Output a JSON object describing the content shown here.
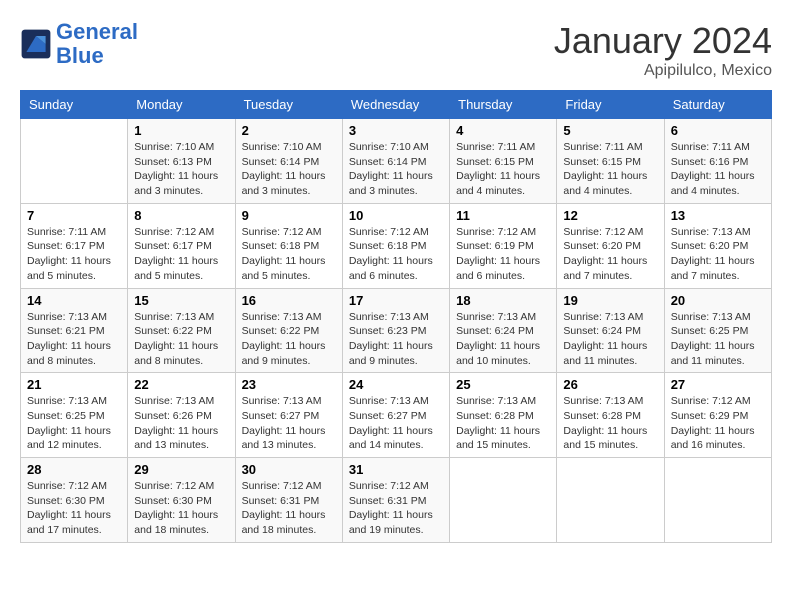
{
  "header": {
    "logo_line1": "General",
    "logo_line2": "Blue",
    "month_year": "January 2024",
    "location": "Apipilulco, Mexico"
  },
  "days_of_week": [
    "Sunday",
    "Monday",
    "Tuesday",
    "Wednesday",
    "Thursday",
    "Friday",
    "Saturday"
  ],
  "weeks": [
    [
      {
        "num": "",
        "info": ""
      },
      {
        "num": "1",
        "info": "Sunrise: 7:10 AM\nSunset: 6:13 PM\nDaylight: 11 hours\nand 3 minutes."
      },
      {
        "num": "2",
        "info": "Sunrise: 7:10 AM\nSunset: 6:14 PM\nDaylight: 11 hours\nand 3 minutes."
      },
      {
        "num": "3",
        "info": "Sunrise: 7:10 AM\nSunset: 6:14 PM\nDaylight: 11 hours\nand 3 minutes."
      },
      {
        "num": "4",
        "info": "Sunrise: 7:11 AM\nSunset: 6:15 PM\nDaylight: 11 hours\nand 4 minutes."
      },
      {
        "num": "5",
        "info": "Sunrise: 7:11 AM\nSunset: 6:15 PM\nDaylight: 11 hours\nand 4 minutes."
      },
      {
        "num": "6",
        "info": "Sunrise: 7:11 AM\nSunset: 6:16 PM\nDaylight: 11 hours\nand 4 minutes."
      }
    ],
    [
      {
        "num": "7",
        "info": "Sunrise: 7:11 AM\nSunset: 6:17 PM\nDaylight: 11 hours\nand 5 minutes."
      },
      {
        "num": "8",
        "info": "Sunrise: 7:12 AM\nSunset: 6:17 PM\nDaylight: 11 hours\nand 5 minutes."
      },
      {
        "num": "9",
        "info": "Sunrise: 7:12 AM\nSunset: 6:18 PM\nDaylight: 11 hours\nand 5 minutes."
      },
      {
        "num": "10",
        "info": "Sunrise: 7:12 AM\nSunset: 6:18 PM\nDaylight: 11 hours\nand 6 minutes."
      },
      {
        "num": "11",
        "info": "Sunrise: 7:12 AM\nSunset: 6:19 PM\nDaylight: 11 hours\nand 6 minutes."
      },
      {
        "num": "12",
        "info": "Sunrise: 7:12 AM\nSunset: 6:20 PM\nDaylight: 11 hours\nand 7 minutes."
      },
      {
        "num": "13",
        "info": "Sunrise: 7:13 AM\nSunset: 6:20 PM\nDaylight: 11 hours\nand 7 minutes."
      }
    ],
    [
      {
        "num": "14",
        "info": "Sunrise: 7:13 AM\nSunset: 6:21 PM\nDaylight: 11 hours\nand 8 minutes."
      },
      {
        "num": "15",
        "info": "Sunrise: 7:13 AM\nSunset: 6:22 PM\nDaylight: 11 hours\nand 8 minutes."
      },
      {
        "num": "16",
        "info": "Sunrise: 7:13 AM\nSunset: 6:22 PM\nDaylight: 11 hours\nand 9 minutes."
      },
      {
        "num": "17",
        "info": "Sunrise: 7:13 AM\nSunset: 6:23 PM\nDaylight: 11 hours\nand 9 minutes."
      },
      {
        "num": "18",
        "info": "Sunrise: 7:13 AM\nSunset: 6:24 PM\nDaylight: 11 hours\nand 10 minutes."
      },
      {
        "num": "19",
        "info": "Sunrise: 7:13 AM\nSunset: 6:24 PM\nDaylight: 11 hours\nand 11 minutes."
      },
      {
        "num": "20",
        "info": "Sunrise: 7:13 AM\nSunset: 6:25 PM\nDaylight: 11 hours\nand 11 minutes."
      }
    ],
    [
      {
        "num": "21",
        "info": "Sunrise: 7:13 AM\nSunset: 6:25 PM\nDaylight: 11 hours\nand 12 minutes."
      },
      {
        "num": "22",
        "info": "Sunrise: 7:13 AM\nSunset: 6:26 PM\nDaylight: 11 hours\nand 13 minutes."
      },
      {
        "num": "23",
        "info": "Sunrise: 7:13 AM\nSunset: 6:27 PM\nDaylight: 11 hours\nand 13 minutes."
      },
      {
        "num": "24",
        "info": "Sunrise: 7:13 AM\nSunset: 6:27 PM\nDaylight: 11 hours\nand 14 minutes."
      },
      {
        "num": "25",
        "info": "Sunrise: 7:13 AM\nSunset: 6:28 PM\nDaylight: 11 hours\nand 15 minutes."
      },
      {
        "num": "26",
        "info": "Sunrise: 7:13 AM\nSunset: 6:28 PM\nDaylight: 11 hours\nand 15 minutes."
      },
      {
        "num": "27",
        "info": "Sunrise: 7:12 AM\nSunset: 6:29 PM\nDaylight: 11 hours\nand 16 minutes."
      }
    ],
    [
      {
        "num": "28",
        "info": "Sunrise: 7:12 AM\nSunset: 6:30 PM\nDaylight: 11 hours\nand 17 minutes."
      },
      {
        "num": "29",
        "info": "Sunrise: 7:12 AM\nSunset: 6:30 PM\nDaylight: 11 hours\nand 18 minutes."
      },
      {
        "num": "30",
        "info": "Sunrise: 7:12 AM\nSunset: 6:31 PM\nDaylight: 11 hours\nand 18 minutes."
      },
      {
        "num": "31",
        "info": "Sunrise: 7:12 AM\nSunset: 6:31 PM\nDaylight: 11 hours\nand 19 minutes."
      },
      {
        "num": "",
        "info": ""
      },
      {
        "num": "",
        "info": ""
      },
      {
        "num": "",
        "info": ""
      }
    ]
  ]
}
